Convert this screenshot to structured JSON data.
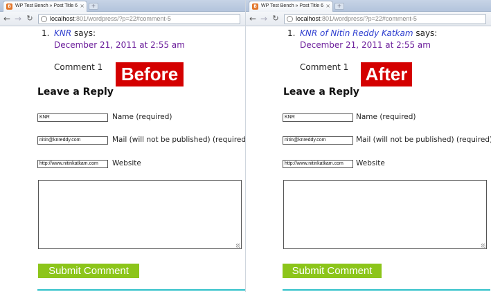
{
  "panels": [
    {
      "tab_title": "WP Test Bench » Post Title 6",
      "url_host": "localhost",
      "url_rest": ":801/wordpress/?p=22#comment-5",
      "comment": {
        "number": "1.",
        "author": "KNR",
        "says": "says:",
        "date": "December 21, 2011 at 2:55 am",
        "text": "Comment 1"
      },
      "badge": "Before",
      "form": {
        "heading": "Leave a Reply",
        "name_value": "KNR",
        "name_label": "Name (required)",
        "mail_value": "nitin@knreddy.com",
        "mail_label": "Mail (will not be published) (required)",
        "website_value": "http://www.nitinkatkam.com",
        "website_label": "Website",
        "submit_label": "Submit Comment"
      }
    },
    {
      "tab_title": "WP Test Bench » Post Title 6",
      "url_host": "localhost",
      "url_rest": ":801/wordpress/?p=22#comment-5",
      "comment": {
        "number": "1.",
        "author": "KNR of Nitin Reddy Katkam",
        "says": "says:",
        "date": "December 21, 2011 at 2:55 am",
        "text": "Comment 1"
      },
      "badge": "After",
      "form": {
        "heading": "Leave a Reply",
        "name_value": "KNR",
        "name_label": "Name (required)",
        "mail_value": "nitin@knreddy.com",
        "mail_label": "Mail (will not be published) (required)",
        "website_value": "http://www.nitinkatkam.com",
        "website_label": "Website",
        "submit_label": "Submit Comment"
      }
    }
  ],
  "icons": {
    "favicon": "blogger-favicon-icon",
    "close": "close-icon",
    "new_tab": "new-tab-icon",
    "back": "back-arrow-icon",
    "forward": "forward-arrow-icon",
    "reload": "reload-icon",
    "page": "page-icon"
  },
  "colors": {
    "badge": "#d40000",
    "submit": "#8cc51a",
    "author_link": "#2f3fd0",
    "date": "#6a1b9a",
    "rule": "#2ec0c9"
  }
}
